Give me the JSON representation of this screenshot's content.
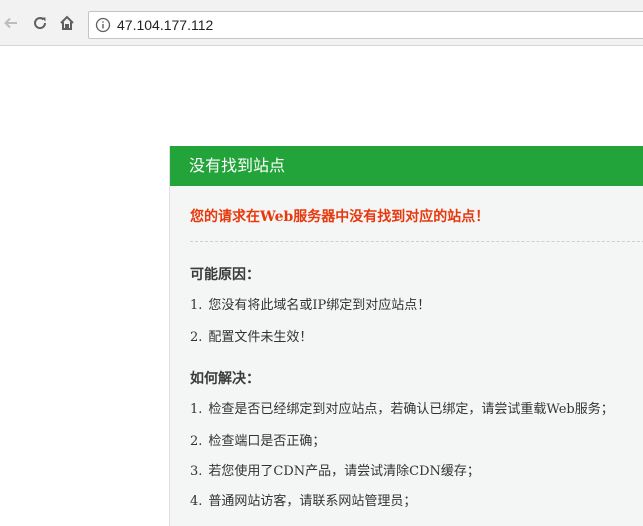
{
  "browser": {
    "url": "47.104.177.112"
  },
  "panel": {
    "title": "没有找到站点",
    "alert": "您的请求在Web服务器中没有找到对应的站点！",
    "reasons": {
      "heading": "可能原因：",
      "items": [
        {
          "num": "1.",
          "text": "您没有将此域名或IP绑定到对应站点！"
        },
        {
          "num": "2.",
          "text": "配置文件未生效！"
        }
      ]
    },
    "solutions": {
      "heading": "如何解决：",
      "items": [
        {
          "num": "1.",
          "text": "检查是否已经绑定到对应站点，若确认已绑定，请尝试重载Web服务；"
        },
        {
          "num": "2.",
          "text": "检查端口是否正确；"
        },
        {
          "num": "3.",
          "text": "若您使用了CDN产品，请尝试清除CDN缓存；"
        },
        {
          "num": "4.",
          "text": "普通网站访客，请联系网站管理员；"
        }
      ]
    }
  },
  "colors": {
    "header_green": "#22a43a",
    "alert_red": "#e8380d"
  }
}
